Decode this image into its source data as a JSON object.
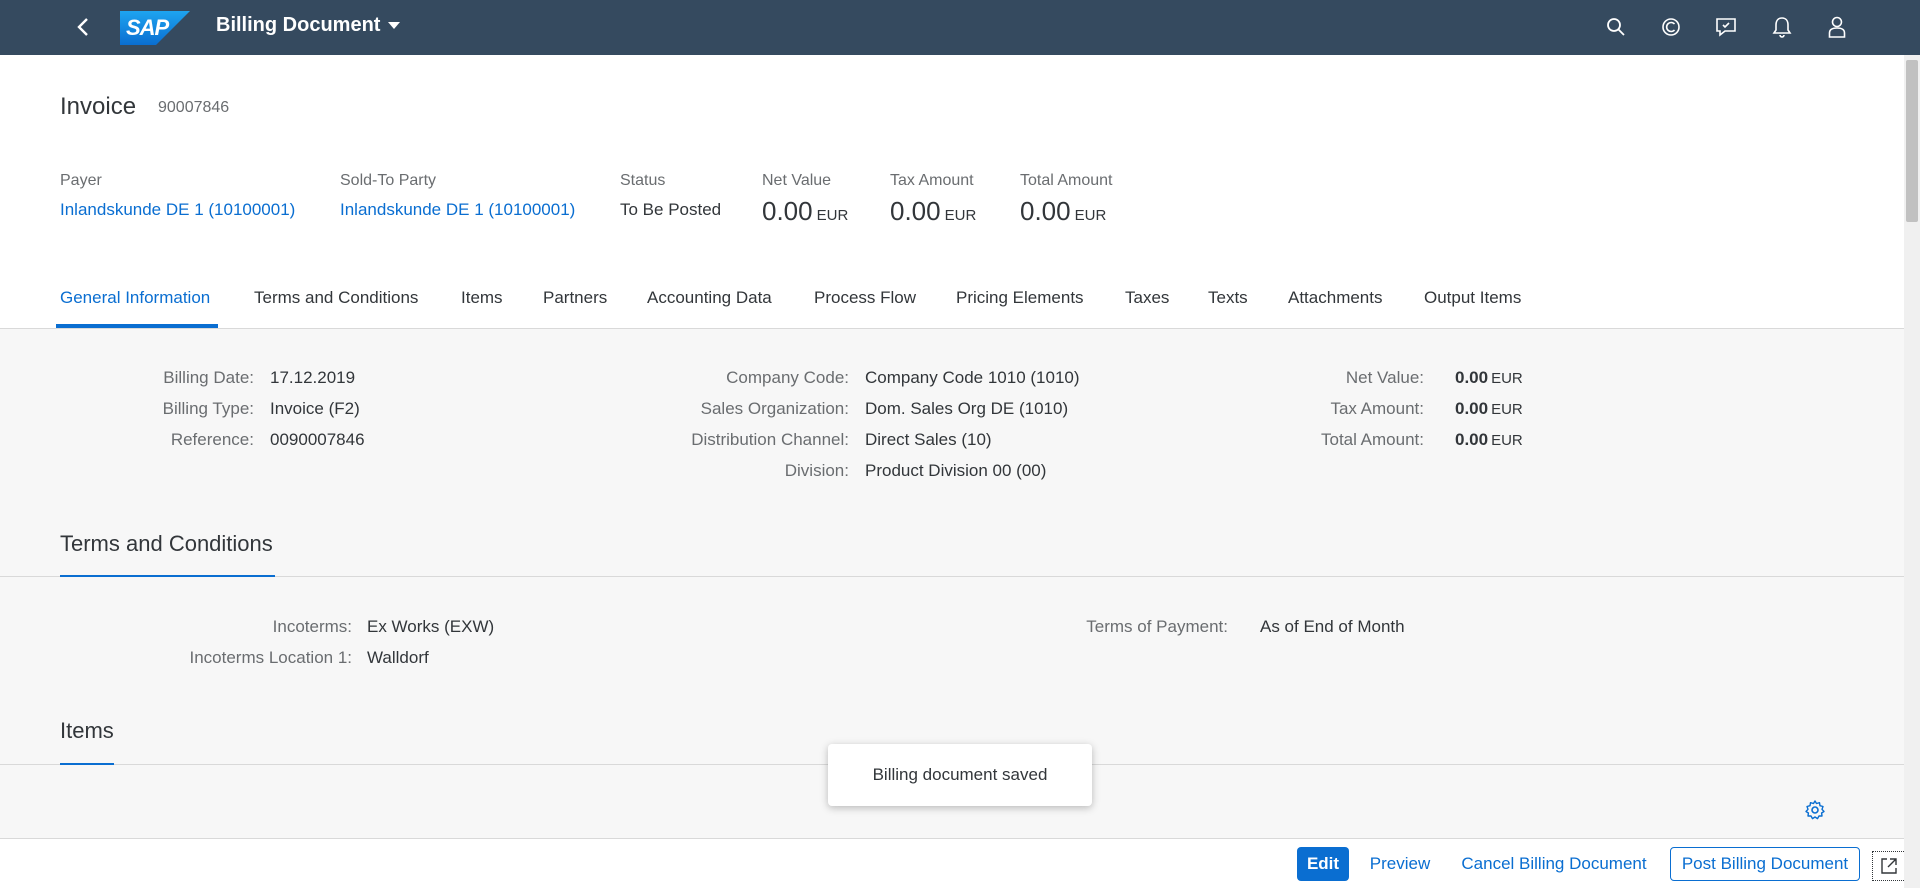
{
  "shell": {
    "app_title": "Billing Document",
    "brand": "SAP"
  },
  "header": {
    "object_type": "Invoice",
    "object_number": "90007846",
    "payer_label": "Payer",
    "payer_value": "Inlandskunde DE 1 (10100001)",
    "soldto_label": "Sold-To Party",
    "soldto_value": "Inlandskunde DE 1 (10100001)",
    "status_label": "Status",
    "status_value": "To Be Posted",
    "net_label": "Net Value",
    "net_value": "0.00",
    "net_unit": "EUR",
    "tax_label": "Tax Amount",
    "tax_value": "0.00",
    "tax_unit": "EUR",
    "total_label": "Total Amount",
    "total_value": "0.00",
    "total_unit": "EUR"
  },
  "tabs": [
    {
      "label": "General Information",
      "active": true
    },
    {
      "label": "Terms and Conditions"
    },
    {
      "label": "Items"
    },
    {
      "label": "Partners"
    },
    {
      "label": "Accounting Data"
    },
    {
      "label": "Process Flow"
    },
    {
      "label": "Pricing Elements"
    },
    {
      "label": "Taxes"
    },
    {
      "label": "Texts"
    },
    {
      "label": "Attachments"
    },
    {
      "label": "Output Items"
    }
  ],
  "general": {
    "billing_date_label": "Billing Date:",
    "billing_date_value": "17.12.2019",
    "billing_type_label": "Billing Type:",
    "billing_type_value": "Invoice (F2)",
    "reference_label": "Reference:",
    "reference_value": "0090007846",
    "company_code_label": "Company Code:",
    "company_code_value": "Company Code 1010 (1010)",
    "sales_org_label": "Sales Organization:",
    "sales_org_value": "Dom. Sales Org DE (1010)",
    "dist_channel_label": "Distribution Channel:",
    "dist_channel_value": "Direct Sales (10)",
    "division_label": "Division:",
    "division_value": "Product Division 00 (00)",
    "net_label": "Net Value:",
    "net_value": "0.00",
    "net_unit": "EUR",
    "tax_label": "Tax Amount:",
    "tax_value": "0.00",
    "tax_unit": "EUR",
    "total_label": "Total Amount:",
    "total_value": "0.00",
    "total_unit": "EUR"
  },
  "terms": {
    "title": "Terms and Conditions",
    "incoterms_label": "Incoterms:",
    "incoterms_value": "Ex Works (EXW)",
    "incoterms_loc_label": "Incoterms Location 1:",
    "incoterms_loc_value": "Walldorf",
    "payment_label": "Terms of Payment:",
    "payment_value": "As of End of Month"
  },
  "items": {
    "title": "Items"
  },
  "toast": {
    "message": "Billing document saved"
  },
  "footer": {
    "edit": "Edit",
    "preview": "Preview",
    "cancel": "Cancel Billing Document",
    "post": "Post Billing Document"
  },
  "colors": {
    "shell": "#354a5f",
    "accent": "#0a6ed1"
  }
}
